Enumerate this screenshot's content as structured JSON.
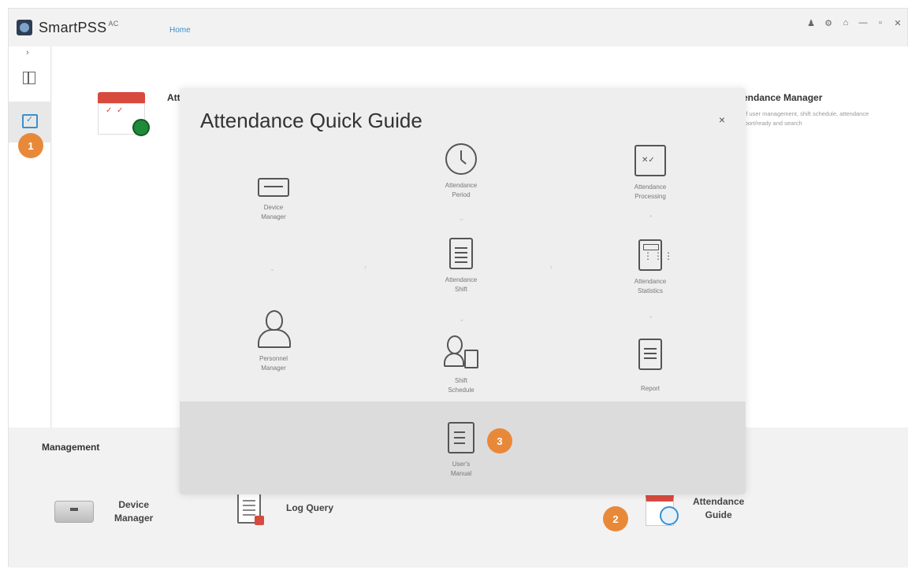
{
  "app": {
    "name": "SmartPSS",
    "name_sup": "AC",
    "home_tab": "Home",
    "window_controls": [
      "user-icon",
      "settings-icon",
      "lock-icon",
      "minimize-icon",
      "maximize-icon",
      "close-icon"
    ]
  },
  "nav": {
    "expand": "›",
    "items": [
      "home-icon",
      "attendance-icon"
    ]
  },
  "cards": {
    "attendance": {
      "title": "Att"
    },
    "manager": {
      "title": "tendance Manager",
      "desc": "pdf user management, shift schedule, attendance report/ready and search"
    }
  },
  "badges": {
    "one": "1",
    "two": "2",
    "three": "3"
  },
  "management": {
    "title": "Management",
    "device_manager": [
      "Device",
      "Manager"
    ],
    "log_query": "Log Query",
    "attendance_guide": [
      "Attendance",
      "Guide"
    ]
  },
  "dialog": {
    "title": "Attendance Quick Guide",
    "close": "×",
    "nodes": {
      "device_manager": [
        "Device",
        "Manager"
      ],
      "attendance_period": [
        "Attendance",
        "Period"
      ],
      "attendance_processing": [
        "Attendance",
        "Processing"
      ],
      "attendance_shift": [
        "Attendance",
        "Shift"
      ],
      "attendance_statistics": [
        "Attendance",
        "Statistics"
      ],
      "personnel_manager": [
        "Personnel",
        "Manager"
      ],
      "shift_schedule": [
        "Shift",
        "Schedule"
      ],
      "report": [
        "Report"
      ],
      "users_manual": [
        "User's",
        "Manual"
      ]
    }
  },
  "colors": {
    "accent": "#3a8fd0",
    "badge": "#e8893a",
    "calendar_red": "#d84a3e"
  }
}
